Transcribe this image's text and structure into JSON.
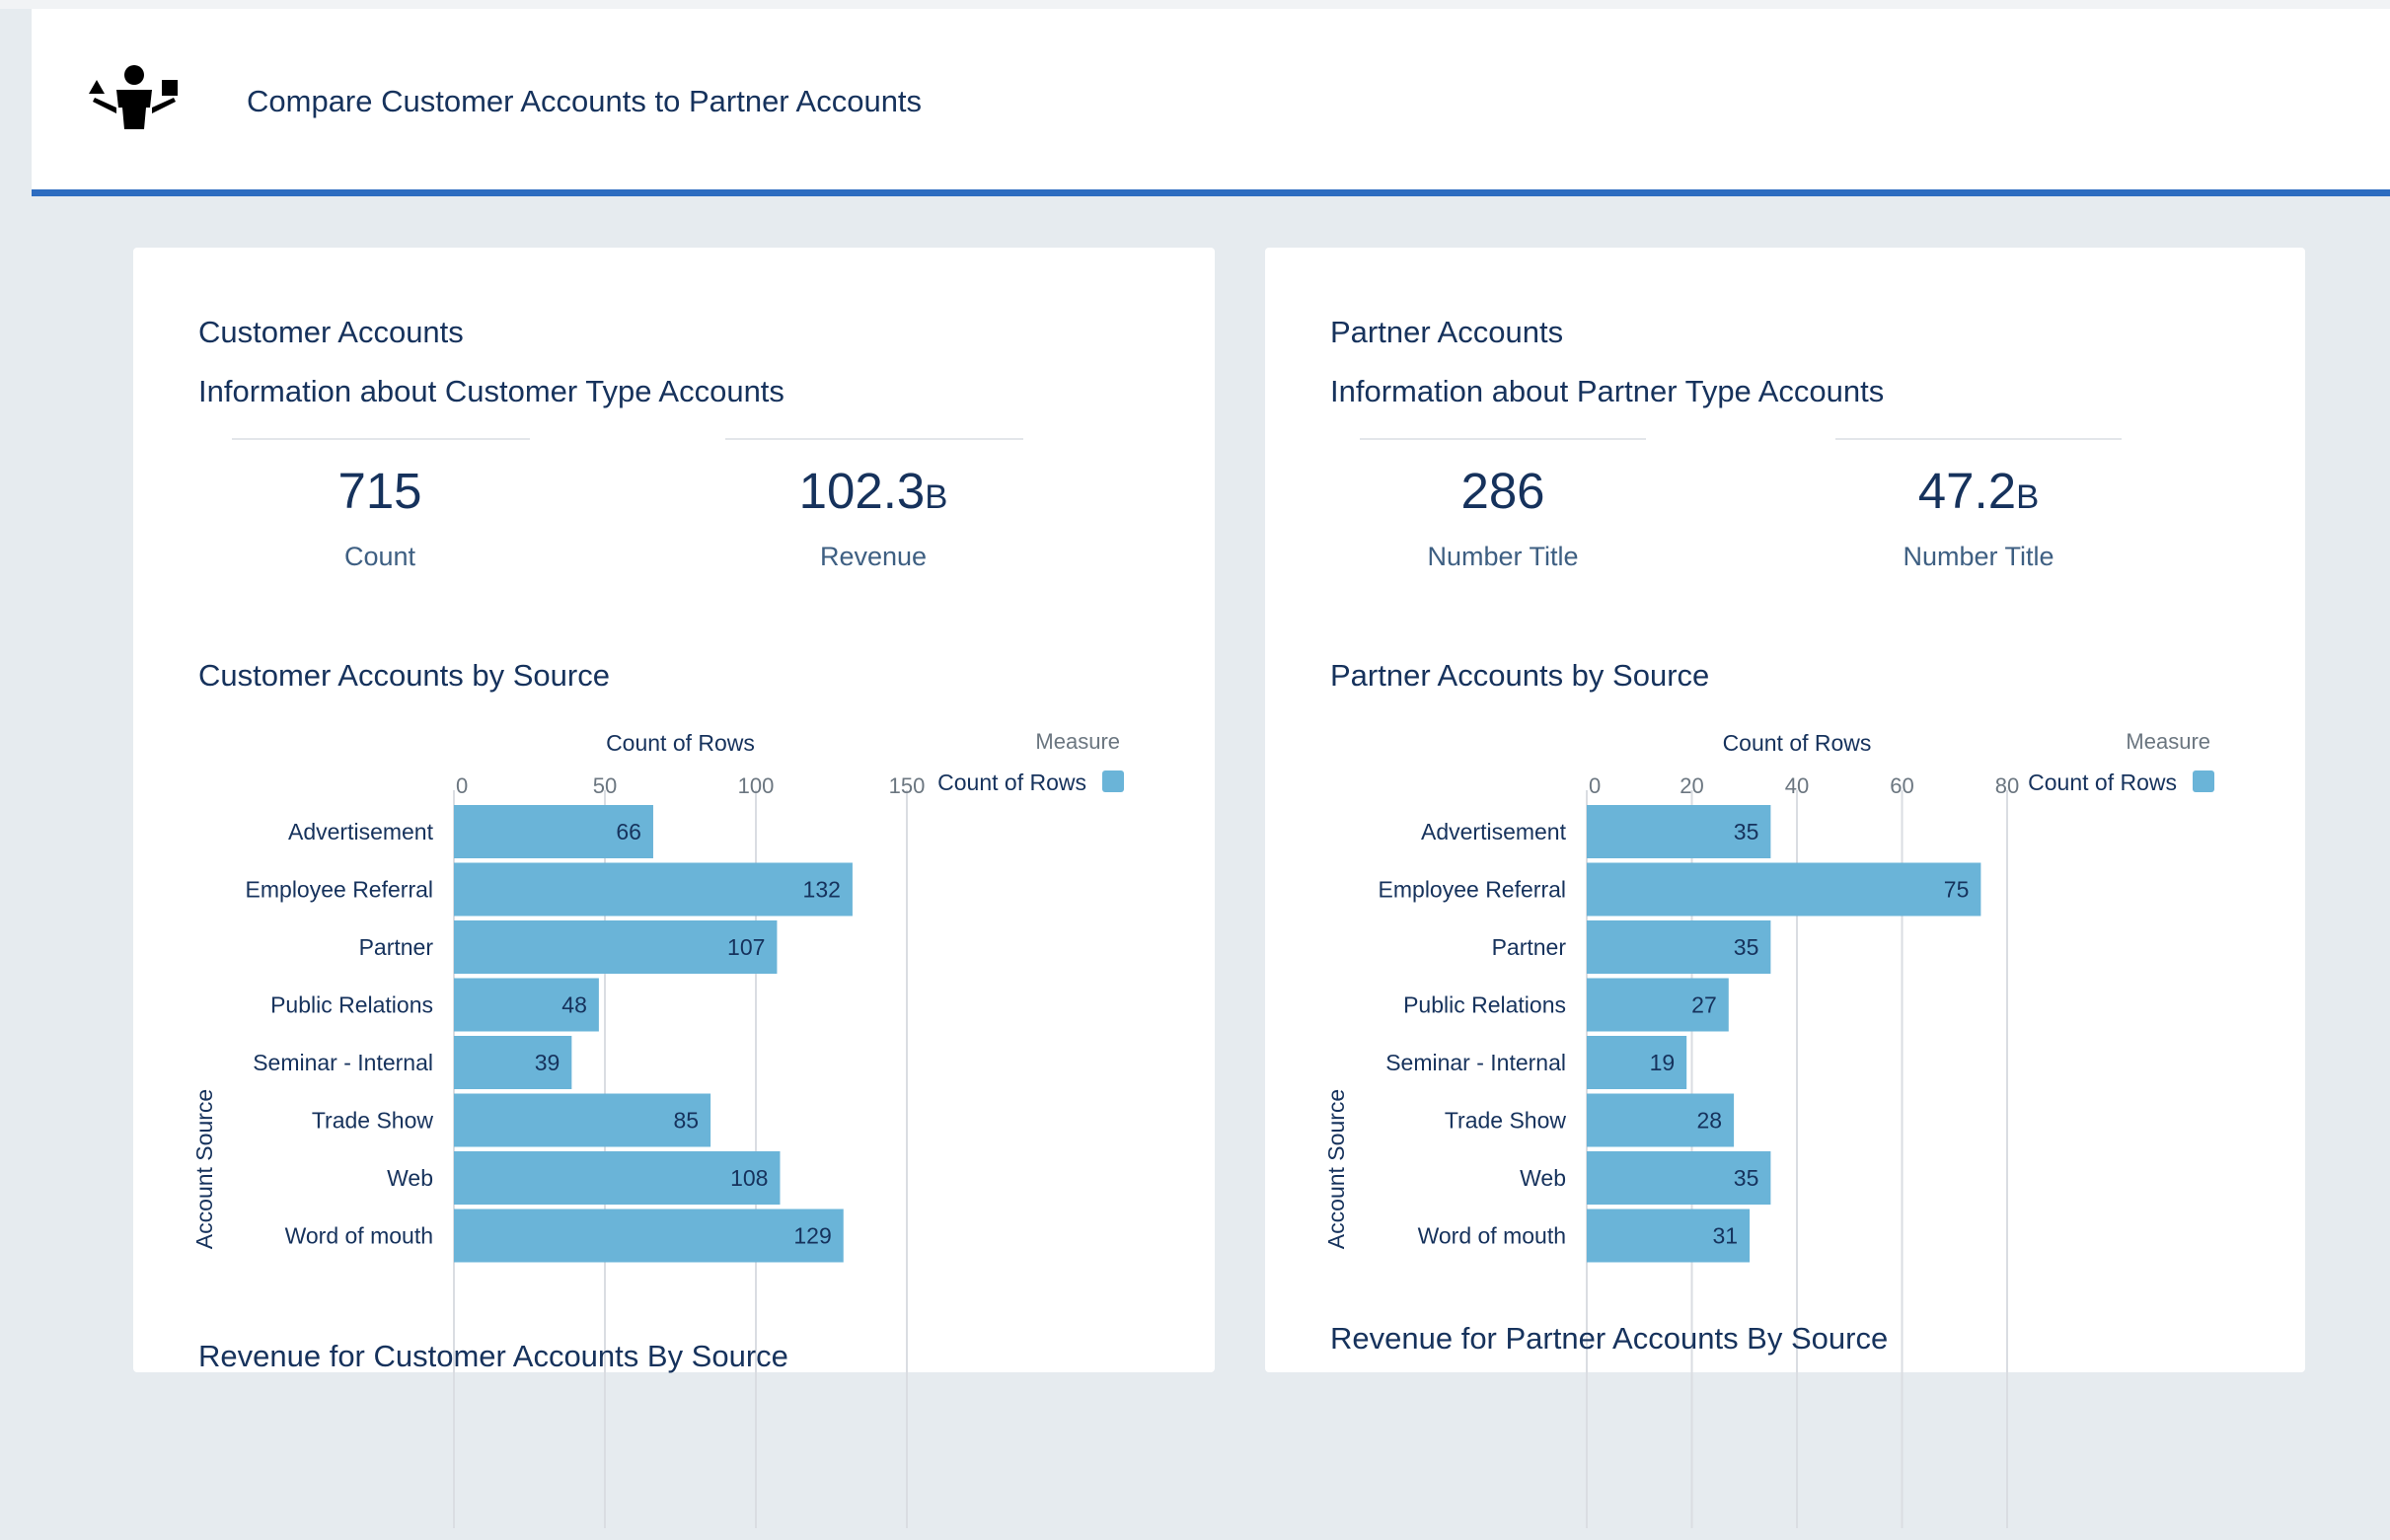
{
  "header": {
    "title": "Compare Customer Accounts to Partner Accounts",
    "icon": "people-balance-icon"
  },
  "customer": {
    "title": "Customer Accounts",
    "subtitle": "Information about Customer Type Accounts",
    "metrics": [
      {
        "value": "715",
        "label": "Count"
      },
      {
        "value": "102.3B",
        "label": "Revenue"
      }
    ],
    "chart_title": "Customer Accounts by Source",
    "next_section_title": "Revenue for Customer Accounts By Source"
  },
  "partner": {
    "title": "Partner Accounts",
    "subtitle": "Information about Partner Type Accounts",
    "metrics": [
      {
        "value": "286",
        "label": "Number Title"
      },
      {
        "value": "47.2B",
        "label": "Number Title"
      }
    ],
    "chart_title": "Partner Accounts by Source",
    "next_section_title": "Revenue for Partner Accounts By Source"
  },
  "chart_data": [
    {
      "type": "bar",
      "orientation": "horizontal",
      "title": "Customer Accounts by Source",
      "xlabel": "Count of Rows",
      "ylabel": "Account Source",
      "categories": [
        "Advertisement",
        "Employee Referral",
        "Partner",
        "Public Relations",
        "Seminar - Internal",
        "Trade Show",
        "Web",
        "Word of mouth"
      ],
      "series": [
        {
          "name": "Count of Rows",
          "values": [
            66,
            132,
            107,
            48,
            39,
            85,
            108,
            129
          ]
        }
      ],
      "xlim": [
        0,
        150
      ],
      "ticks": [
        0,
        50,
        100,
        150
      ],
      "legend_title": "Measure",
      "legend_position": "top-right",
      "bar_color": "#6ab4d8",
      "grid": true
    },
    {
      "type": "bar",
      "orientation": "horizontal",
      "title": "Partner Accounts by Source",
      "xlabel": "Count of Rows",
      "ylabel": "Account Source",
      "categories": [
        "Advertisement",
        "Employee Referral",
        "Partner",
        "Public Relations",
        "Seminar - Internal",
        "Trade Show",
        "Web",
        "Word of mouth"
      ],
      "series": [
        {
          "name": "Count of Rows",
          "values": [
            35,
            75,
            35,
            27,
            19,
            28,
            35,
            31
          ]
        }
      ],
      "xlim": [
        0,
        80
      ],
      "ticks": [
        0,
        20,
        40,
        60,
        80
      ],
      "legend_title": "Measure",
      "legend_position": "top-right",
      "bar_color": "#6ab4d8",
      "grid": true
    }
  ]
}
